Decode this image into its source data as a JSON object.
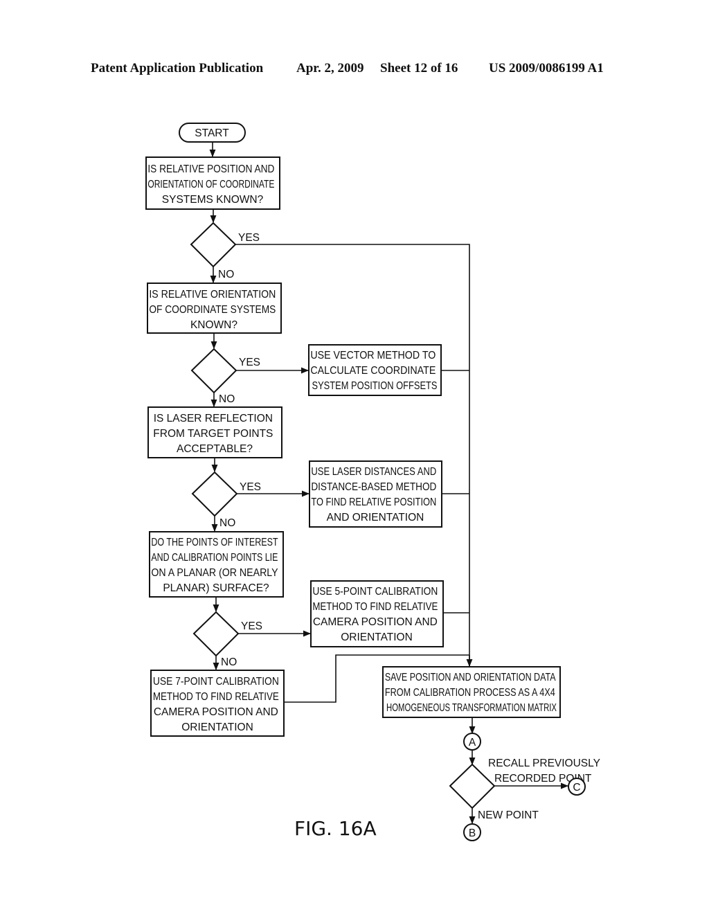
{
  "header": {
    "publication": "Patent Application Publication",
    "date": "Apr. 2, 2009",
    "sheet": "Sheet 12 of 16",
    "number": "US 2009/0086199 A1"
  },
  "figure_label": "FIG. 16A",
  "flowchart": {
    "start": "START",
    "q1": [
      "IS RELATIVE POSITION AND",
      "ORIENTATION OF COORDINATE",
      "SYSTEMS KNOWN?"
    ],
    "q2": [
      "IS RELATIVE ORIENTATION",
      "OF COORDINATE SYSTEMS",
      "KNOWN?"
    ],
    "vector": [
      "USE VECTOR METHOD TO",
      "CALCULATE COORDINATE",
      "SYSTEM POSITION OFFSETS"
    ],
    "q3": [
      "IS LASER REFLECTION",
      "FROM TARGET POINTS",
      "ACCEPTABLE?"
    ],
    "laser": [
      "USE LASER DISTANCES AND",
      "DISTANCE-BASED METHOD",
      "TO FIND RELATIVE POSITION",
      "AND ORIENTATION"
    ],
    "q4": [
      "DO THE POINTS OF INTEREST",
      "AND CALIBRATION POINTS LIE",
      "ON A PLANAR (OR NEARLY",
      "PLANAR) SURFACE?"
    ],
    "five_point": [
      "USE 5-POINT CALIBRATION",
      "METHOD TO FIND RELATIVE",
      "CAMERA POSITION AND",
      "ORIENTATION"
    ],
    "seven_point": [
      "USE 7-POINT CALIBRATION",
      "METHOD TO FIND RELATIVE",
      "CAMERA POSITION AND",
      "ORIENTATION"
    ],
    "save": [
      "SAVE POSITION AND ORIENTATION DATA",
      "FROM CALIBRATION PROCESS AS A 4X4",
      "HOMOGENEOUS TRANSFORMATION MATRIX"
    ],
    "yes": "YES",
    "no": "NO",
    "recall": [
      "RECALL PREVIOUSLY",
      "RECORDED POINT"
    ],
    "new_point": "NEW POINT",
    "connector_a": "A",
    "connector_b": "B",
    "connector_c": "C"
  }
}
